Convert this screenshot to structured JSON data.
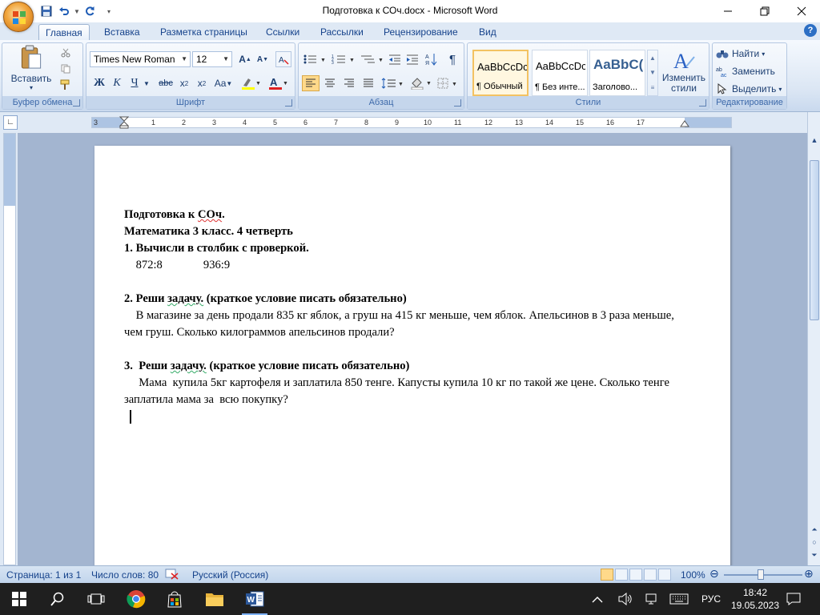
{
  "window": {
    "title": "Подготовка к СОч.docx - Microsoft Word",
    "minimize": "—",
    "maximize": "❐",
    "close": "✕"
  },
  "qat": {
    "save": "💾",
    "undo": "↶",
    "redo": "↻",
    "customize": "▾"
  },
  "tabs": [
    {
      "label": "Главная",
      "active": true
    },
    {
      "label": "Вставка"
    },
    {
      "label": "Разметка страницы"
    },
    {
      "label": "Ссылки"
    },
    {
      "label": "Рассылки"
    },
    {
      "label": "Рецензирование"
    },
    {
      "label": "Вид"
    }
  ],
  "ribbon": {
    "clipboard": {
      "label": "Буфер обмена",
      "paste": "Вставить"
    },
    "font": {
      "label": "Шрифт",
      "family": "Times New Roman",
      "size": "12"
    },
    "paragraph": {
      "label": "Абзац"
    },
    "styles": {
      "label": "Стили",
      "items": [
        {
          "sample": "AaBbCcDc",
          "name": "¶ Обычный"
        },
        {
          "sample": "AaBbCcDc",
          "name": "¶ Без инте..."
        },
        {
          "sample": "AaBbC(",
          "name": "Заголово..."
        }
      ],
      "change": "Изменить стили"
    },
    "editing": {
      "label": "Редактирование",
      "find": "Найти",
      "replace": "Заменить",
      "select": "Выделить"
    }
  },
  "ruler": {
    "labels": [
      "3",
      "1",
      "1",
      "2",
      "3",
      "4",
      "5",
      "6",
      "7",
      "8",
      "9",
      "10",
      "11",
      "12",
      "13",
      "14",
      "15",
      "16",
      "17"
    ]
  },
  "document": {
    "line1": "Подготовка к ",
    "line1_sq": "СОч",
    "line1_end": ".",
    "line2": "Математика 3 класс. 4 четверть",
    "line3": "1. Вычисли в столбик с проверкой.",
    "line4": "    872:8              936:9",
    "task2_head_a": "2. Реши ",
    "task2_head_sq": "задачу.",
    "task2_head_b": " (краткое условие писать обязательно)",
    "task2_body": "    В магазине за день продали 835 кг яблок, а груш на 415 кг меньше, чем яблок. Апельсинов в 3 раза меньше, чем груш. Сколько килограммов апельсинов продали?",
    "task3_head_a": "3.  Реши ",
    "task3_head_sq": "задачу.",
    "task3_head_b": " (краткое условие писать обязательно)",
    "task3_body": "     Мама  купила 5кг картофеля и заплатила 850 тенге. Капусты купила 10 кг по такой же цене. Сколько тенге заплатила мама за  всю покупку?"
  },
  "status": {
    "page": "Страница: 1 из 1",
    "words": "Число слов: 80",
    "language": "Русский (Россия)",
    "zoom": "100%"
  },
  "taskbar": {
    "lang": "РУС",
    "time": "18:42",
    "date": "19.05.2023"
  }
}
